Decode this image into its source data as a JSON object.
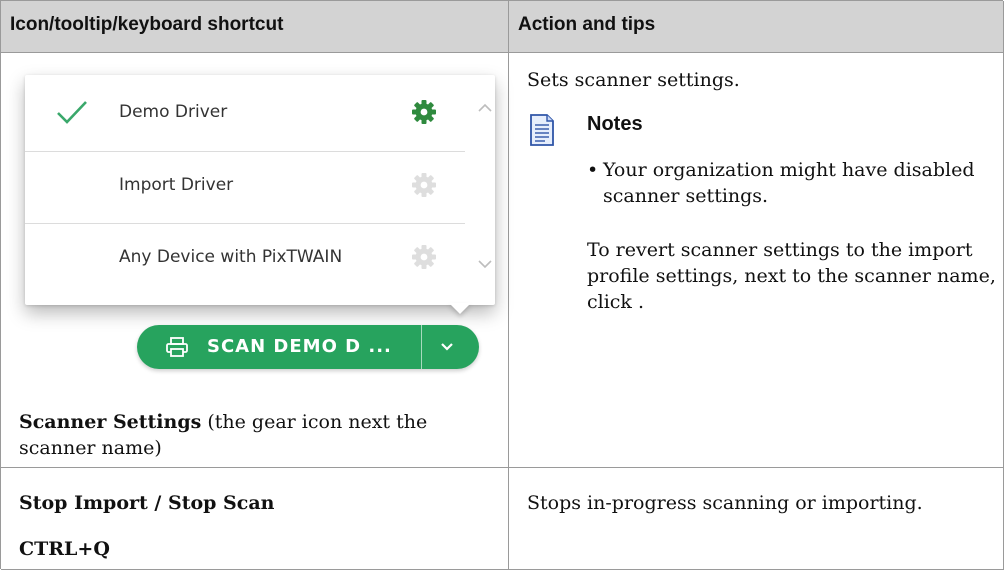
{
  "table": {
    "header_left": "Icon/tooltip/keyboard shortcut",
    "header_right": "Action and tips"
  },
  "screenshot": {
    "drivers": [
      {
        "label": "Demo Driver",
        "selected": true
      },
      {
        "label": "Import Driver",
        "selected": false
      },
      {
        "label": "Any Device with PixTWAIN",
        "selected": false
      }
    ],
    "scan_button_label": "SCAN DEMO D ...",
    "accent_color": "#27a35e",
    "icons": [
      "check-icon",
      "gear-icon",
      "chevron-up-icon",
      "chevron-down-icon",
      "printer-icon",
      "dropdown-chevron-icon"
    ]
  },
  "row1": {
    "left_label_bold": "Scanner Settings",
    "left_label_rest": " (the gear icon next the scanner name)",
    "right_intro": "Sets scanner settings.",
    "notes_title": "Notes",
    "note_bullet": "Your organization might have disabled scanner settings.",
    "revert_text": "To revert scanner settings to the import profile settings, next to the scanner name, click ."
  },
  "row2": {
    "left_label": "Stop Import / Stop Scan",
    "shortcut": "CTRL+Q",
    "right_text": "Stops in-progress scanning or importing."
  }
}
